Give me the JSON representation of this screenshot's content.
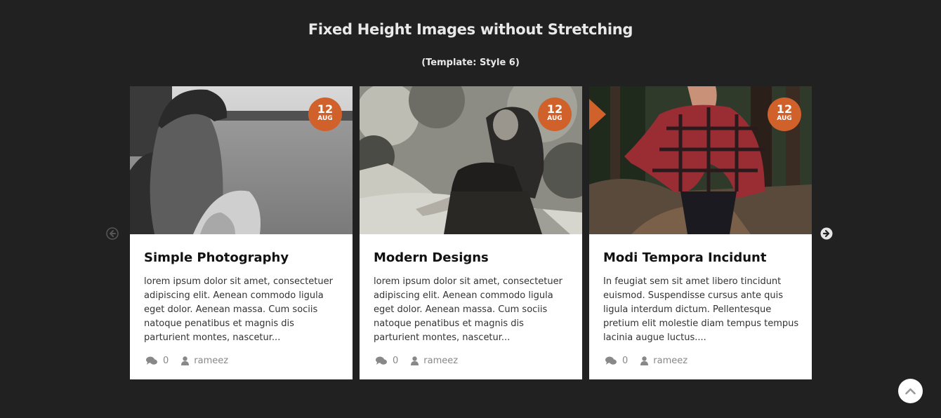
{
  "page": {
    "title": "Fixed Height Images without Stretching",
    "subtitle": "(Template: Style 6)"
  },
  "colors": {
    "background": "#212121",
    "accent": "#d0612b",
    "card": "#ffffff"
  },
  "cards": [
    {
      "title": "Simple Photography",
      "excerpt": "lorem ipsum dolor sit amet, consectetuer adipiscing elit. Aenean commodo ligula eget dolor. Aenean massa. Cum sociis natoque penatibus et magnis dis parturient montes, nascetur...",
      "day": "12",
      "month": "AUG",
      "comments": "0",
      "author": "rameez",
      "image": "woman-by-lake-photo"
    },
    {
      "title": "Modern Designs",
      "excerpt": "lorem ipsum dolor sit amet, consectetuer adipiscing elit. Aenean commodo ligula eget dolor. Aenean massa. Cum sociis natoque penatibus et magnis dis parturient montes, nascetur...",
      "day": "12",
      "month": "AUG",
      "comments": "0",
      "author": "rameez",
      "image": "woman-on-phone-photo"
    },
    {
      "title": "Modi Tempora Incidunt",
      "excerpt": "In feugiat sem sit amet libero tincidunt euismod. Suspendisse cursus ante quis ligula interdum dictum. Pellentesque pretium elit molestie diam tempus tempus lacinia augue luctus....",
      "day": "12",
      "month": "AUG",
      "comments": "0",
      "author": "rameez",
      "image": "woman-in-forest-photo"
    }
  ],
  "icons": {
    "prev": "arrow-circle-left-icon",
    "next": "arrow-circle-right-icon",
    "comments": "comments-icon",
    "author": "user-icon",
    "scroll_top": "chevron-up-icon"
  }
}
